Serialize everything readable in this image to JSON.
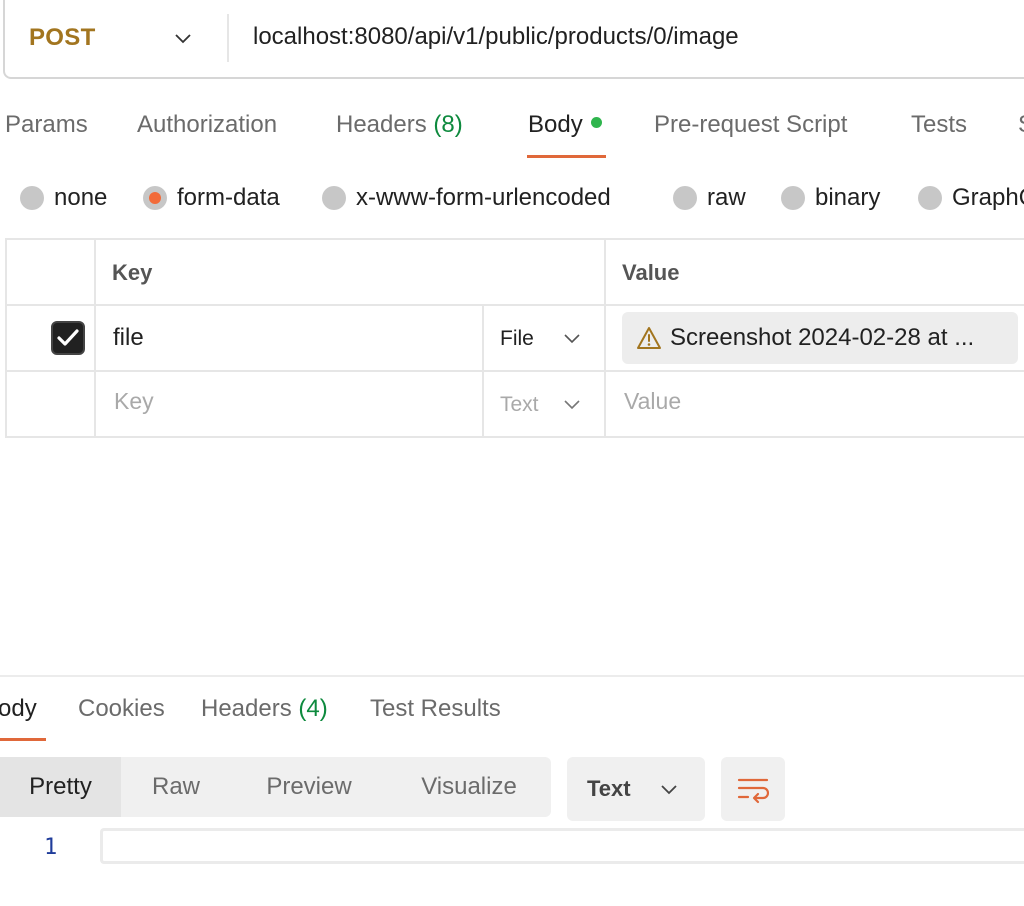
{
  "request": {
    "method": "POST",
    "url": "localhost:8080/api/v1/public/products/0/image"
  },
  "request_tabs": {
    "params": "Params",
    "authorization": "Authorization",
    "headers_label": "Headers",
    "headers_count": "(8)",
    "body": "Body",
    "pre_request": "Pre-request Script",
    "tests": "Tests",
    "settings_partial": "S",
    "active": "Body"
  },
  "body_types": {
    "none": "none",
    "form_data": "form-data",
    "urlencoded": "x-www-form-urlencoded",
    "raw": "raw",
    "binary": "binary",
    "graphql_partial": "GraphQ",
    "selected": "form-data"
  },
  "form_table": {
    "headers": {
      "key": "Key",
      "value": "Value"
    },
    "rows": [
      {
        "checked": true,
        "key": "file",
        "type": "File",
        "value": "Screenshot 2024-02-28 at ...",
        "warning": true
      }
    ],
    "empty_row": {
      "key_placeholder": "Key",
      "type": "Text",
      "value_placeholder": "Value"
    }
  },
  "response": {
    "tabs": {
      "body_partial": "ody",
      "cookies": "Cookies",
      "headers_label": "Headers",
      "headers_count": "(4)",
      "test_results": "Test Results",
      "active": "Body"
    },
    "view_modes": [
      "Pretty",
      "Raw",
      "Preview",
      "Visualize"
    ],
    "active_view": "Pretty",
    "format": "Text",
    "line_numbers": [
      "1"
    ]
  },
  "colors": {
    "method": "#a2751f",
    "accent": "#e0683a",
    "radio_selected": "#f26b3a",
    "count_green": "#0e8a3e",
    "body_dot": "#2fb54d",
    "line_number": "#1f3c9a"
  },
  "icons": {
    "method_dropdown": "chevron-down-icon",
    "warning": "warning-triangle-icon",
    "wrap": "word-wrap-icon",
    "checkbox": "checkmark-icon"
  }
}
